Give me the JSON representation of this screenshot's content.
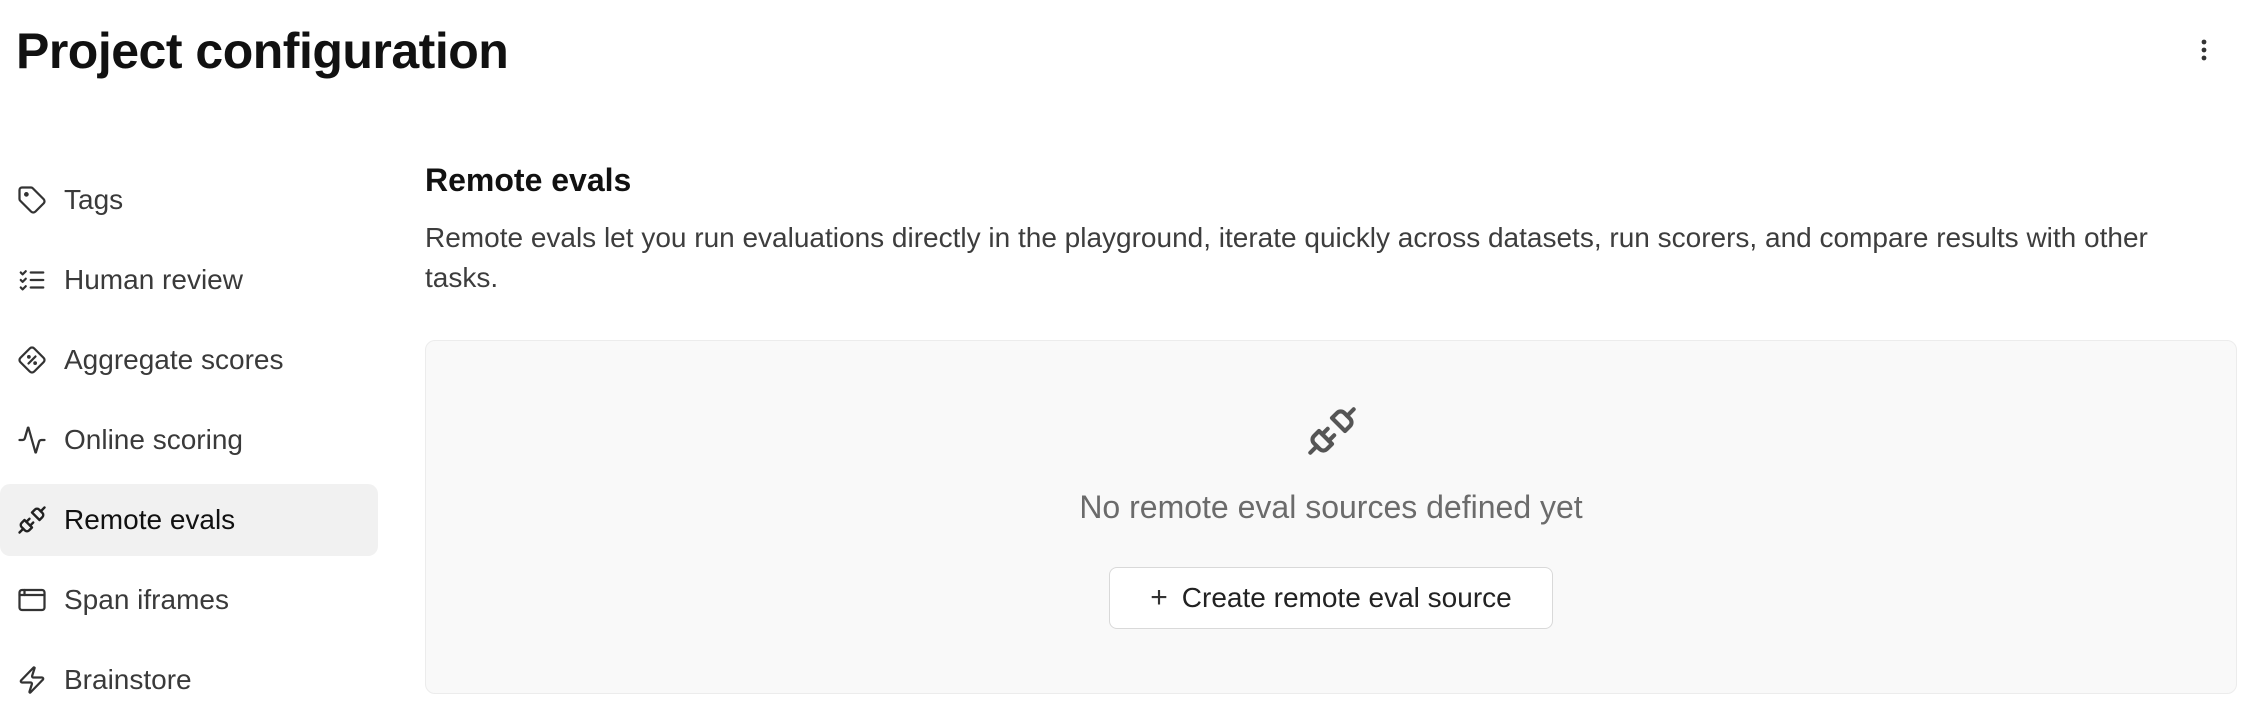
{
  "header": {
    "title": "Project configuration",
    "more_icon": "more-vertical-icon"
  },
  "sidebar": {
    "items": [
      {
        "label": "Tags",
        "icon": "tag-icon",
        "active": false
      },
      {
        "label": "Human review",
        "icon": "list-checks-icon",
        "active": false
      },
      {
        "label": "Aggregate scores",
        "icon": "diamond-percent-icon",
        "active": false
      },
      {
        "label": "Online scoring",
        "icon": "activity-icon",
        "active": false
      },
      {
        "label": "Remote evals",
        "icon": "unplug-icon",
        "active": true
      },
      {
        "label": "Span iframes",
        "icon": "app-window-icon",
        "active": false
      },
      {
        "label": "Brainstore",
        "icon": "zap-icon",
        "active": false
      }
    ]
  },
  "main": {
    "section_title": "Remote evals",
    "section_description": "Remote evals let you run evaluations directly in the playground, iterate quickly across datasets, run scorers, and compare results with other tasks.",
    "empty_state": {
      "icon": "unplug-icon",
      "message": "No remote eval sources defined yet",
      "button_icon": "plus-icon",
      "button_label": "Create remote eval source"
    }
  },
  "colors": {
    "active_item_bg": "#f1f1f1",
    "empty_box_bg": "#f9f9f9",
    "text_primary": "#111111",
    "text_muted": "#6b6b6b"
  }
}
